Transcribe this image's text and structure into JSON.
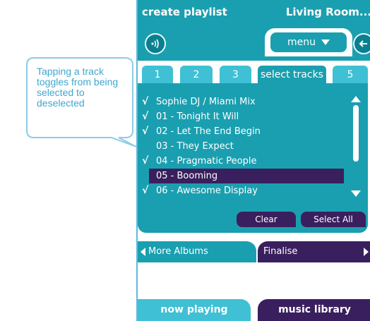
{
  "callout": {
    "text": "Tapping a track toggles from being selected to deselected"
  },
  "header": {
    "title": "create playlist",
    "location": "Living Room..."
  },
  "toolbar": {
    "speaker_icon": "speaker-icon",
    "menu_label": "menu",
    "back_icon": "back-arrow-icon"
  },
  "tabs": [
    {
      "label": "1"
    },
    {
      "label": "2"
    },
    {
      "label": "3"
    },
    {
      "label": "select tracks"
    },
    {
      "label": "5"
    }
  ],
  "tracks": [
    {
      "label": "Sophie DJ / Miami Mix",
      "checked": true
    },
    {
      "label": "01 - Tonight It Will",
      "checked": true
    },
    {
      "label": "02 - Let The End Begin",
      "checked": true
    },
    {
      "label": "03 - They Expect",
      "checked": false
    },
    {
      "label": "04 - Pragmatic People",
      "checked": true
    },
    {
      "label": "05 - Booming",
      "checked": false
    },
    {
      "label": "06 - Awesome Display",
      "checked": true
    }
  ],
  "check_glyph": "√",
  "buttons": {
    "clear": "Clear",
    "select_all": "Select All"
  },
  "nav": {
    "more_albums": "More Albums",
    "finalise": "Finalise"
  },
  "bottom_tabs": {
    "now_playing": "now playing",
    "music_library": "music library"
  },
  "colors": {
    "teal": "#1a9fb0",
    "light_teal": "#3fc0d4",
    "purple": "#3a1f5e",
    "callout": "#3ea6cf"
  }
}
